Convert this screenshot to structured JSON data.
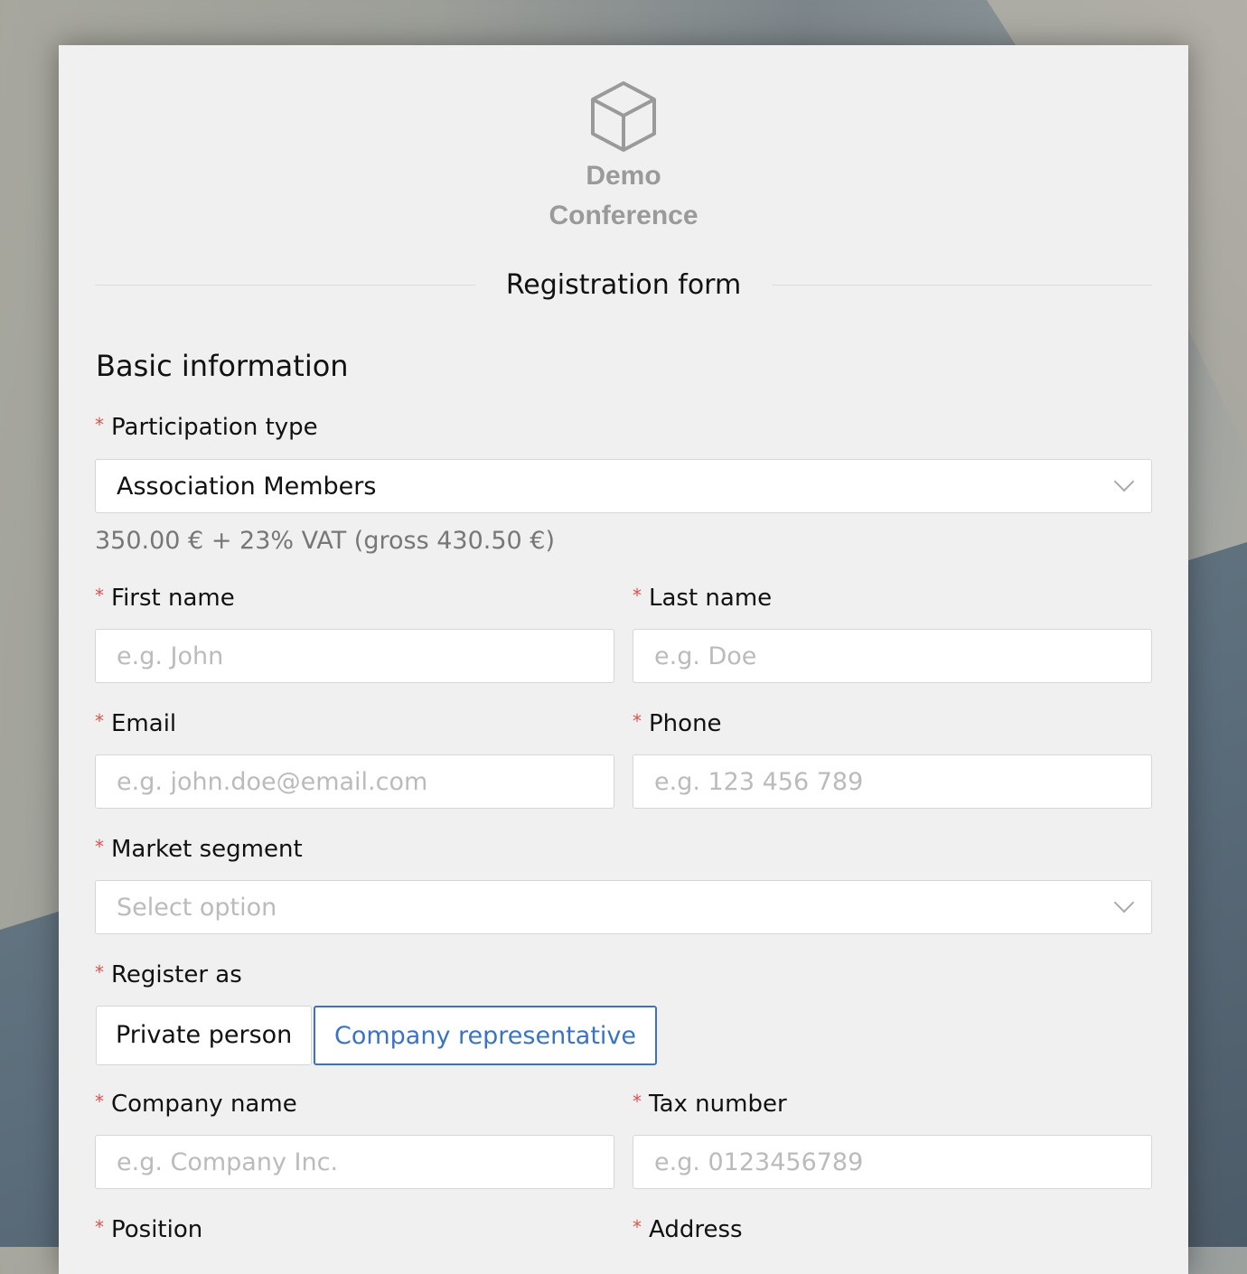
{
  "logo": {
    "icon": "cube-icon",
    "line1": "Demo",
    "line2": "Conference"
  },
  "form_title": "Registration form",
  "section_title": "Basic information",
  "required_marker": "*",
  "participation": {
    "label": "Participation type",
    "value": "Association Members",
    "price_note": "350.00 € + 23% VAT (gross 430.50 €)"
  },
  "first_name": {
    "label": "First name",
    "placeholder": "e.g. John"
  },
  "last_name": {
    "label": "Last name",
    "placeholder": "e.g. Doe"
  },
  "email": {
    "label": "Email",
    "placeholder": "e.g. john.doe@email.com"
  },
  "phone": {
    "label": "Phone",
    "placeholder": "e.g. 123 456 789"
  },
  "market_segment": {
    "label": "Market segment",
    "placeholder": "Select option"
  },
  "register_as": {
    "label": "Register as",
    "options": [
      "Private person",
      "Company representative"
    ],
    "selected": "Company representative"
  },
  "company_name": {
    "label": "Company name",
    "placeholder": "e.g. Company Inc."
  },
  "tax_number": {
    "label": "Tax number",
    "placeholder": "e.g. 0123456789"
  },
  "position": {
    "label": "Position"
  },
  "address": {
    "label": "Address"
  },
  "colors": {
    "accent": "#3b73c4",
    "required": "#d9534f"
  }
}
